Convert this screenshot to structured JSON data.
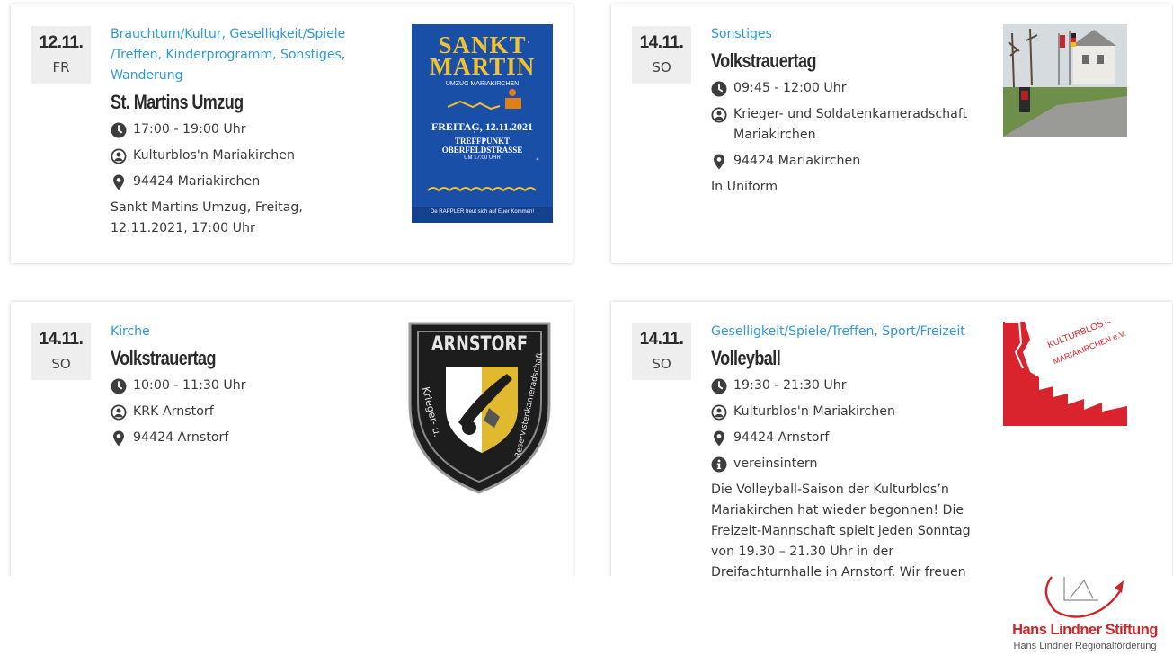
{
  "events": [
    {
      "date": "12.11.",
      "weekday": "FR",
      "categories": "Brauchtum/Kultur, Geselligkeit/Spiele /Treffen, Kinderprogramm, Sonstiges, Wanderung",
      "title": "St. Martins Umzug",
      "time": "17:00 - 19:00 Uhr",
      "organizer": "Kulturblos'n Mariakirchen",
      "location": "94424 Mariakirchen",
      "description": "Sankt Martins Umzug, Freitag, 12.11.2021, 17:00 Uhr",
      "image": {
        "line1": "SANKT",
        "line2": "MARTIN",
        "subtitle": "UMZUG MARIAKIRCHEN",
        "date_text": "FREITAG, 12.11.2021",
        "meet1": "TREFFPUNKT",
        "meet2": "OBERFELDSTRASSE",
        "meet3": "UM 17:00 UHR",
        "footer": "De RAPPLER freut sich auf Euer Kommen!"
      }
    },
    {
      "date": "14.11.",
      "weekday": "SO",
      "categories": "Sonstiges",
      "title": "Volkstrauertag",
      "time": "09:45 - 12:00 Uhr",
      "organizer": "Krieger- und Soldatenkameradschaft Mariakirchen",
      "location": "94424 Mariakirchen",
      "description": "In Uniform"
    },
    {
      "date": "14.11.",
      "weekday": "SO",
      "categories": "Kirche",
      "title": "Volkstrauertag",
      "time": "10:00 - 11:30 Uhr",
      "organizer": "KRK Arnstorf",
      "location": "94424 Arnstorf",
      "image": {
        "top": "ARNSTORF",
        "left": "Krieger- u.",
        "bottom": "Reservistenkameradschaft"
      }
    },
    {
      "date": "14.11.",
      "weekday": "SO",
      "categories": "Geselligkeit/Spiele/Treffen, Sport/Freizeit",
      "title": "Volleyball",
      "time": "19:30 - 21:30 Uhr",
      "organizer": "Kulturblos'n Mariakirchen",
      "location": "94424 Arnstorf",
      "info": "vereinsintern",
      "description": "Die Volleyball-Saison der Kulturblos’n Mariakirchen hat wieder begonnen! Die Freizeit-Mannschaft spielt jeden Sonntag von 19.30 – 21.30 Uhr in der Dreifachturnhalle in Arnstorf. Wir freuen",
      "image": {
        "line1": "KULTURBLOS'N",
        "line2": "MARIAKIRCHEN e.V."
      }
    }
  ],
  "footer_logo": {
    "title": "Hans Lindner Stiftung",
    "subtitle": "Hans Lindner Regionalförderung"
  },
  "colors": {
    "category_link": "#2f9ad6",
    "date_box": "#eeeeee",
    "brand_red": "#d2232a",
    "icon": "#3d3d3d"
  },
  "icons": [
    "clock-icon",
    "user-circle-icon",
    "map-marker-icon",
    "info-circle-icon"
  ]
}
